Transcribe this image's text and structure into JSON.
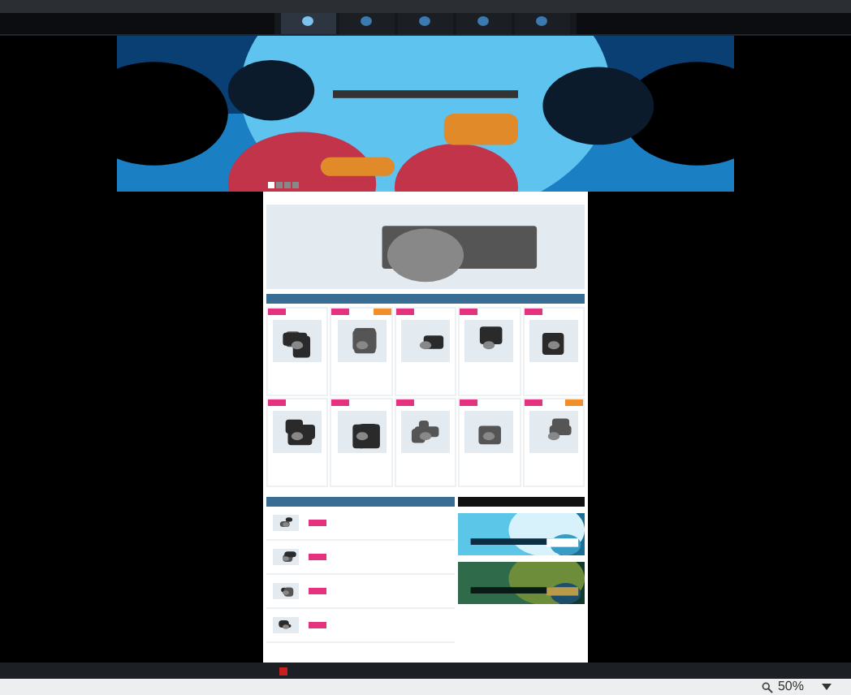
{
  "nav": {
    "items": [
      {
        "selected": true
      },
      {
        "selected": false
      },
      {
        "selected": false
      },
      {
        "selected": false
      },
      {
        "selected": false
      }
    ]
  },
  "banner": {
    "kind": "picture"
  },
  "slider": {
    "dots": [
      {
        "selected": true
      },
      {
        "selected": false
      },
      {
        "selected": false
      },
      {
        "selected": false
      }
    ]
  },
  "promo_banner": {
    "kind": "picture"
  },
  "new_products": {
    "items": [
      {
        "kind": "picture",
        "extra_badge": false
      },
      {
        "kind": "picture",
        "extra_badge": true
      },
      {
        "kind": "picture",
        "extra_badge": false
      },
      {
        "kind": "picture",
        "extra_badge": false
      },
      {
        "kind": "picture",
        "extra_badge": false
      },
      {
        "kind": "picture",
        "extra_badge": false
      },
      {
        "kind": "picture",
        "extra_badge": false
      },
      {
        "kind": "picture",
        "extra_badge": false
      },
      {
        "kind": "picture",
        "extra_badge": false
      },
      {
        "kind": "picture",
        "extra_badge": true
      }
    ]
  },
  "promos": {
    "rows": [
      {
        "kind": "picture"
      },
      {
        "kind": "picture"
      },
      {
        "kind": "picture"
      },
      {
        "kind": "picture"
      }
    ]
  },
  "blog": {
    "posts": [
      {
        "kind": "picture"
      },
      {
        "kind": "picture"
      }
    ]
  },
  "status_bar": {
    "zoom": "50%"
  }
}
